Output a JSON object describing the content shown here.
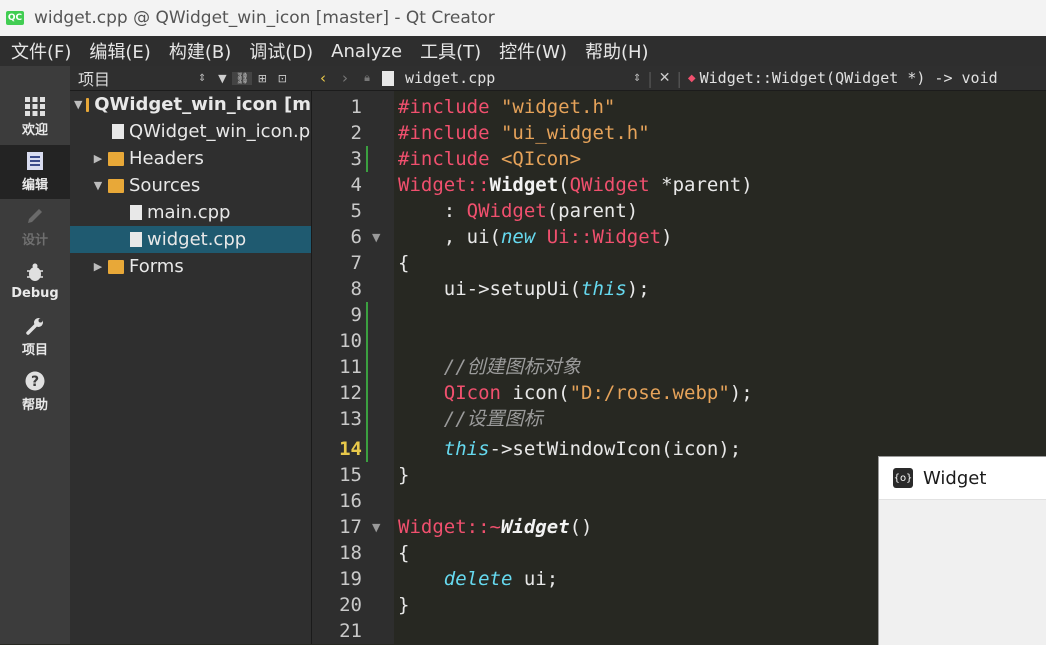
{
  "window": {
    "title": "widget.cpp @ QWidget_win_icon [master] - Qt Creator",
    "app_badge": "QC"
  },
  "menu": [
    "文件(F)",
    "编辑(E)",
    "构建(B)",
    "调试(D)",
    "Analyze",
    "工具(T)",
    "控件(W)",
    "帮助(H)"
  ],
  "modes": [
    {
      "label": "欢迎",
      "icon": "grid-icon"
    },
    {
      "label": "编辑",
      "icon": "document-icon"
    },
    {
      "label": "设计",
      "icon": "pencil-icon"
    },
    {
      "label": "Debug",
      "icon": "bug-icon"
    },
    {
      "label": "项目",
      "icon": "wrench-icon"
    },
    {
      "label": "帮助",
      "icon": "question-icon"
    }
  ],
  "project_panel": {
    "title": "项目",
    "tree": [
      {
        "label": "QWidget_win_icon [m"
      },
      {
        "label": "QWidget_win_icon.p"
      },
      {
        "label": "Headers"
      },
      {
        "label": "Sources"
      },
      {
        "label": "main.cpp"
      },
      {
        "label": "widget.cpp"
      },
      {
        "label": "Forms"
      }
    ]
  },
  "editor": {
    "file_name": "widget.cpp",
    "function_signature": "Widget::Widget(QWidget *) -> void",
    "line_numbers": [
      "1",
      "2",
      "3",
      "4",
      "5",
      "6",
      "7",
      "8",
      "9",
      "10",
      "11",
      "12",
      "13",
      "14",
      "15",
      "16",
      "17",
      "18",
      "19",
      "20",
      "21"
    ],
    "current_line": "14",
    "code": {
      "l1a": "#include ",
      "l1b": "\"widget.h\"",
      "l2a": "#include ",
      "l2b": "\"ui_widget.h\"",
      "l3a": "#include ",
      "l3b": "<QIcon>",
      "l4a": "Widget::",
      "l4b": "Widget",
      "l4c": "(",
      "l4d": "QWidget",
      "l4e": " *parent)",
      "l5a": "    : ",
      "l5b": "QWidget",
      "l5c": "(parent)",
      "l6a": "    , ui(",
      "l6b": "new",
      "l6c": " ",
      "l6d": "Ui::Widget",
      "l6e": ")",
      "l7": "{",
      "l8a": "    ui->setupUi(",
      "l8b": "this",
      "l8c": ");",
      "l11": "    //创建图标对象",
      "l12a": "    ",
      "l12b": "QIcon",
      "l12c": " icon(",
      "l12d": "\"D:/rose.webp\"",
      "l12e": ");",
      "l13": "    //设置图标",
      "l14a": "    ",
      "l14b": "this",
      "l14c": "->setWindowIcon(icon);",
      "l15": "}",
      "l17a": "Widget::~",
      "l17b": "Widget",
      "l17c": "()",
      "l18": "{",
      "l19a": "    ",
      "l19b": "delete",
      "l19c": " ui;",
      "l20": "}"
    }
  },
  "widget_window": {
    "title": "Widget"
  }
}
